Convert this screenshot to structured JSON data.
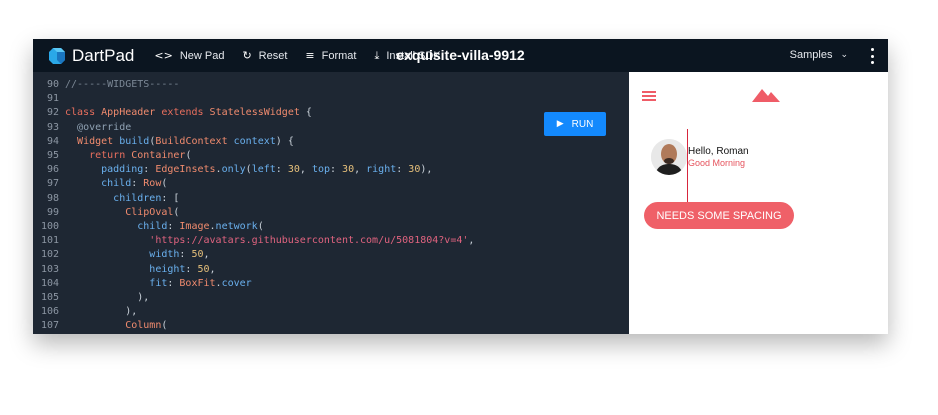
{
  "app": {
    "brand": "DartPad",
    "pad_title": "exquisite-villa-9912",
    "accent": "#1389fd"
  },
  "toolbar": {
    "new_pad": {
      "label": "New Pad",
      "icon": "code-icon"
    },
    "reset": {
      "label": "Reset",
      "icon": "refresh-icon"
    },
    "format": {
      "label": "Format",
      "icon": "format-lines-icon"
    },
    "install": {
      "label": "Install SDK",
      "icon": "download-icon"
    },
    "samples": {
      "label": "Samples",
      "icon": "chevron-down-icon"
    },
    "more": {
      "icon": "more-vertical-icon"
    }
  },
  "editor": {
    "run_label": "RUN",
    "lines": [
      {
        "n": "90",
        "code": "//-----WIDGETS-----"
      },
      {
        "n": "91",
        "code": ""
      },
      {
        "n": "92",
        "code": "class AppHeader extends StatelessWidget {"
      },
      {
        "n": "93",
        "code": "  @override"
      },
      {
        "n": "94",
        "code": "  Widget build(BuildContext context) {"
      },
      {
        "n": "95",
        "code": "    return Container("
      },
      {
        "n": "96",
        "code": "      padding: EdgeInsets.only(left: 30, top: 30, right: 30),"
      },
      {
        "n": "97",
        "code": "      child: Row("
      },
      {
        "n": "98",
        "code": "        children: ["
      },
      {
        "n": "99",
        "code": "          ClipOval("
      },
      {
        "n": "100",
        "code": "            child: Image.network("
      },
      {
        "n": "101",
        "code": "              'https://avatars.githubusercontent.com/u/5081804?v=4',"
      },
      {
        "n": "102",
        "code": "              width: 50,"
      },
      {
        "n": "103",
        "code": "              height: 50,"
      },
      {
        "n": "104",
        "code": "              fit: BoxFit.cover"
      },
      {
        "n": "105",
        "code": "            ),"
      },
      {
        "n": "106",
        "code": "          ),"
      },
      {
        "n": "107",
        "code": "          Column("
      }
    ]
  },
  "preview": {
    "name": "Hello, Roman",
    "greeting": "Good Morning",
    "button_label": "NEEDS SOME SPACING",
    "accent": "#ef6068"
  }
}
